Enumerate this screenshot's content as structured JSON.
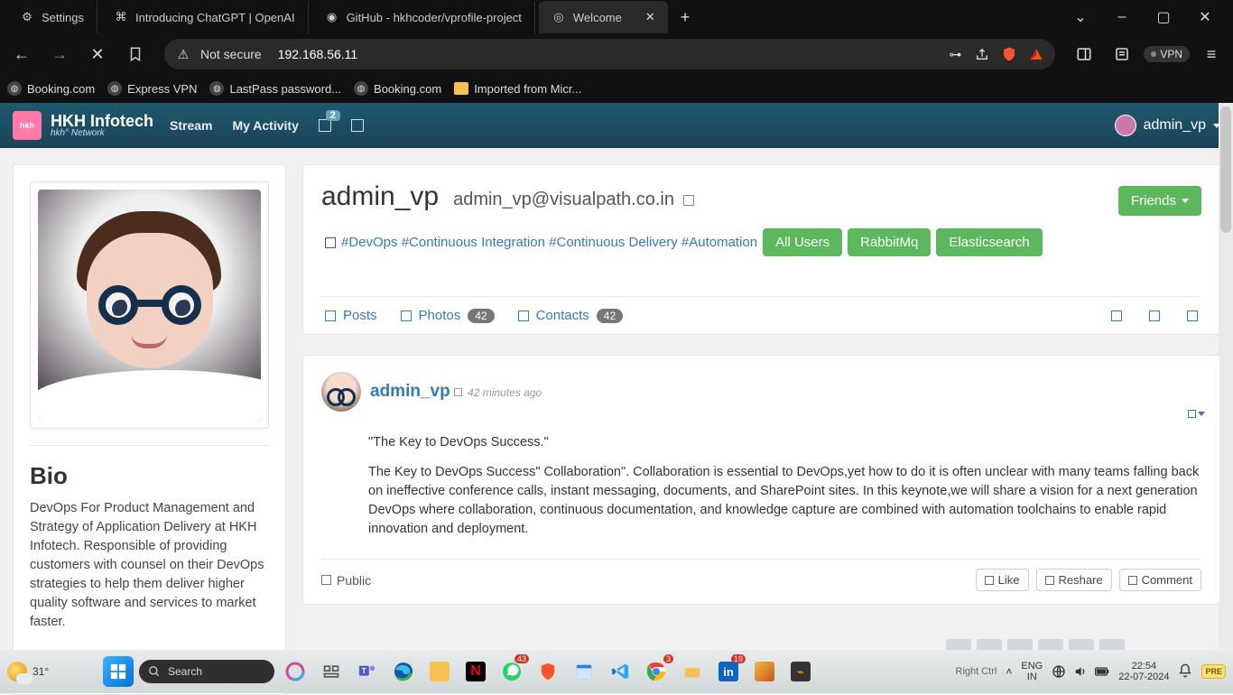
{
  "browser": {
    "tabs": [
      {
        "label": "Settings"
      },
      {
        "label": "Introducing ChatGPT | OpenAI"
      },
      {
        "label": "GitHub - hkhcoder/vprofile-project"
      },
      {
        "label": "Welcome",
        "active": true
      }
    ],
    "window_controls": {
      "min": "–",
      "max": "▢",
      "close": "✕",
      "dropdown": "⌄"
    },
    "nav": {
      "back": "←",
      "forward": "→",
      "stop": "✕",
      "bookmark": "☆"
    },
    "address": {
      "warn_icon": "⚠",
      "warn_text": "Not secure",
      "url": "192.168.56.11"
    },
    "addr_icons": {
      "key": "⊙",
      "share": "↗",
      "brave": "brave-icon",
      "bat": "bat-icon",
      "panel": "◫",
      "reader": "▤"
    },
    "vpn": "VPN",
    "menu": "≡",
    "bookmarks": [
      {
        "label": "Booking.com"
      },
      {
        "label": "Express VPN"
      },
      {
        "label": "LastPass password..."
      },
      {
        "label": "Booking.com"
      },
      {
        "label": "Imported from Micr...",
        "folder": true
      }
    ]
  },
  "app": {
    "brand_name": "HKH Infotech",
    "brand_sub": "hkh° Network",
    "nav": {
      "stream": "Stream",
      "activity": "My Activity"
    },
    "notif_badge": "2",
    "user": "admin_vp"
  },
  "sidebar": {
    "bio_heading": "Bio",
    "bio_text": "DevOps For Product Management and Strategy of Application Delivery at HKH Infotech. Responsible of providing customers with counsel on their DevOps strategies to help them deliver higher quality software and services to market faster."
  },
  "profile": {
    "username": "admin_vp",
    "email": "admin_vp@visualpath.co.in",
    "friends_btn": "Friends",
    "tags": "#DevOps #Continuous Integration #Continuous Delivery #Automation",
    "buttons": {
      "all_users": "All Users",
      "rabbit": "RabbitMq",
      "elastic": "Elasticsearch"
    },
    "tabs": {
      "posts": "Posts",
      "photos": "Photos",
      "photos_count": "42",
      "contacts": "Contacts",
      "contacts_count": "42"
    }
  },
  "post": {
    "author": "admin_vp",
    "time": "42 minutes ago",
    "title": "\"The Key to DevOps Success.\"",
    "body": "The Key to DevOps Success\" Collaboration\". Collaboration is essential to DevOps,yet how to do it is often unclear with many teams falling back on ineffective conference calls, instant messaging, documents, and SharePoint sites. In this keynote,we will share a vision for a next generation DevOps where collaboration, continuous documentation, and knowledge capture are combined with automation toolchains to enable rapid innovation and deployment.",
    "visibility": "Public",
    "actions": {
      "like": "Like",
      "reshare": "Reshare",
      "comment": "Comment"
    }
  },
  "taskbar": {
    "temp": "31°",
    "search": "Search",
    "lang1": "ENG",
    "lang2": "IN",
    "time": "22:54",
    "date": "22-07-2024",
    "right_ctrl": "Right Ctrl",
    "pre": "PRE"
  }
}
